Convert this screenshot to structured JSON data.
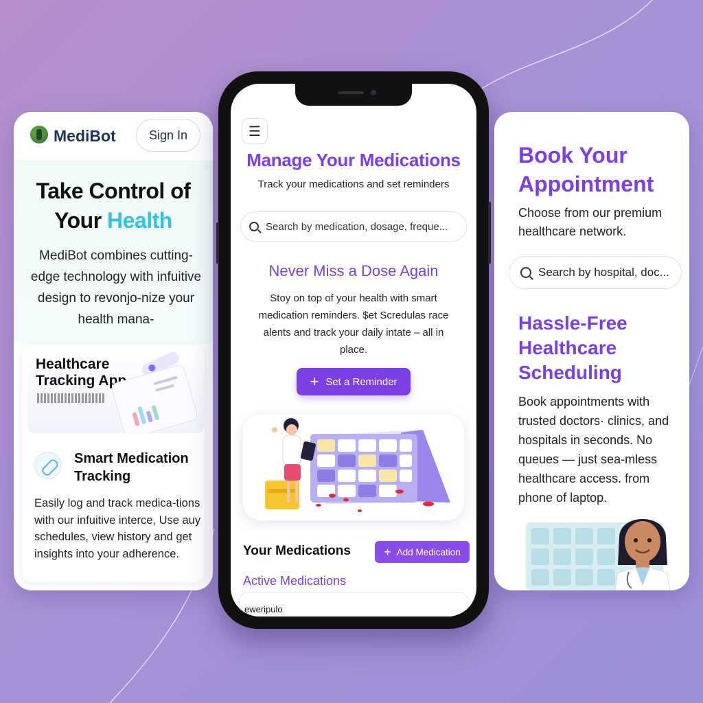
{
  "left_card": {
    "brand": "MediBot",
    "signin_label": "Sign In",
    "hero_title_line1": "Take Control of",
    "hero_title_your": "Your ",
    "hero_title_accent": "Health",
    "hero_description": "MediBot combines cutting-edge technology with infuitive design to revonjo-nize your health mana-",
    "feature_image_title": "Healthcare Tracking App",
    "feature_title": "Smart Medication Tracking",
    "feature_description": "Easily log and track medica-tions with our infuitive interce, Use auy schedules, view history and get insights into your adherence."
  },
  "phone": {
    "title": "Manage Your Medications",
    "subtitle": "Track your medications and set reminders",
    "search_placeholder": "Search by medication, dosage, freque...",
    "section_title": "Never Miss a Dose Again",
    "section_text": "Stoy on top of your health with smart medication reminders. $et Scredulas race alents and track your daily intate – all in place.",
    "cta_label": "Set a Reminder",
    "your_medications": "Your Medications",
    "add_medication_label": "Add Medication",
    "active_medications": "Active Medications",
    "first_item": "eweripulo"
  },
  "right_card": {
    "title": "Book Your Appointment",
    "subtitle": "Choose from our premium healthcare network.",
    "search_placeholder": "Search by hospital, doc...",
    "section_title": "Hassle-Free Healthcare Scheduling",
    "section_text": "Book appointments with trusted doctors· clinics, and hospitals in seconds. No queues — just sea-mless healthcare access. from phone of laptop."
  },
  "icons": {
    "menu": "menu-icon",
    "search": "search-icon",
    "plus": "plus-icon",
    "pill": "pill-icon",
    "logo": "medibot-logo-icon"
  },
  "colors": {
    "accent_purple": "#7b3fe4",
    "accent_cyan": "#33c3df",
    "brand_navy": "#1d3557"
  }
}
